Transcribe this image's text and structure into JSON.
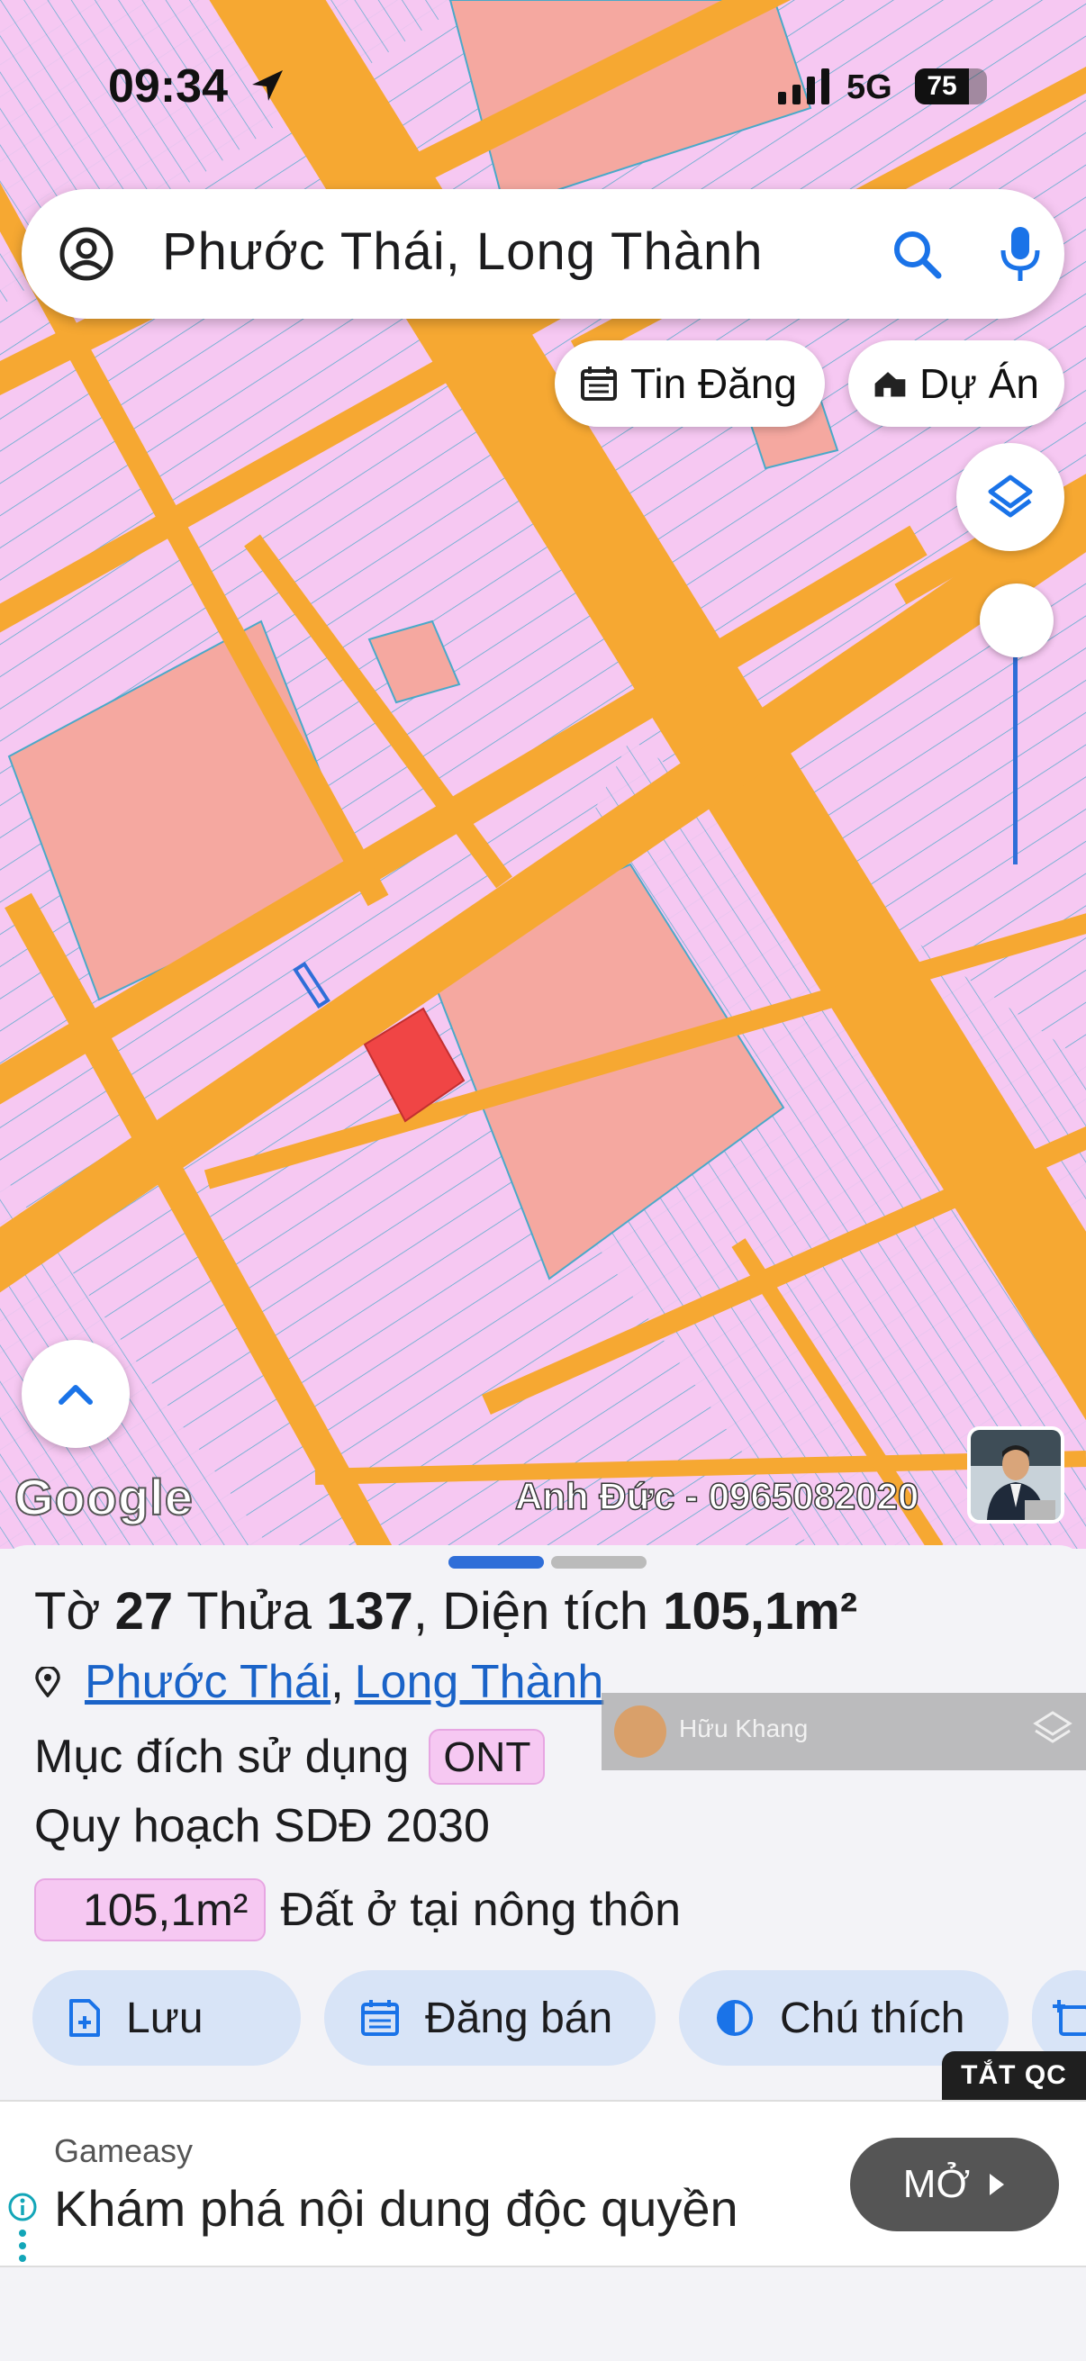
{
  "status_bar": {
    "time": "09:34",
    "network": "5G",
    "battery": "75",
    "battery_level": 0.75
  },
  "search": {
    "query": "Phước Thái, Long Thành"
  },
  "map_chips": {
    "listings": "Tin Đăng",
    "projects": "Dự Án"
  },
  "map": {
    "logo": "Google",
    "agent_tag": "Anh Đức - 0965082020",
    "colors": {
      "residential": "#f6c8f2",
      "road": "#f6a832",
      "commercial": "#f5a8a0",
      "selected": "#f04545",
      "parcel_line": "#4aa9c9"
    }
  },
  "parcel": {
    "sheet_label": "Tờ",
    "sheet_no": "27",
    "lot_label": "Thửa",
    "lot_no": "137",
    "area_label": ", Diện tích",
    "area": "105,1m²",
    "ward": "Phước Thái",
    "district": "Long Thành",
    "purpose_label": "Mục đích sử dụng",
    "purpose_code": "ONT",
    "plan_label": "Quy hoạch SDĐ 2030",
    "plan_area": "105,1m²",
    "plan_desc": "Đất ở tại nông thôn"
  },
  "actions": {
    "save": "Lưu",
    "post": "Đăng bán",
    "legend": "Chú thích"
  },
  "watermark": {
    "name": "Hữu Khang"
  },
  "ad": {
    "off_label": "TẮT QC",
    "brand": "Gameasy",
    "text": "Khám phá nội dung độc quyền",
    "open_label": "MỞ"
  }
}
